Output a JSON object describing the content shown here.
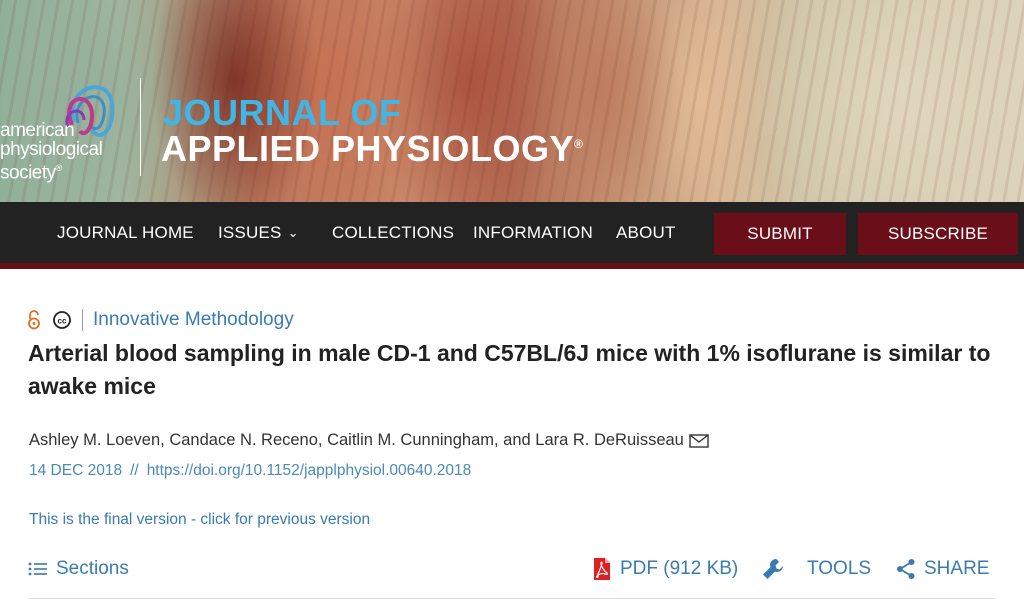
{
  "banner": {
    "society_name_lines": [
      "american",
      "physiological",
      "society"
    ],
    "society_name_suffix": "®",
    "journal_line1": "JOURNAL OF",
    "journal_line2": "APPLIED PHYSIOLOGY",
    "journal_line2_suffix": "®",
    "colors": {
      "journal_line1": "#3fb6e6",
      "journal_line2": "#ffffff"
    }
  },
  "nav": {
    "items": [
      {
        "label": "JOURNAL HOME"
      },
      {
        "label": "ISSUES",
        "has_dropdown": true
      },
      {
        "label": "COLLECTIONS"
      },
      {
        "label": "INFORMATION"
      },
      {
        "label": "ABOUT"
      }
    ],
    "submit_label": "SUBMIT",
    "subscribe_label": "SUBSCRIBE",
    "colors": {
      "bar": "#222222",
      "accent": "#6a0e1a"
    }
  },
  "article": {
    "icons": [
      "open-access-icon",
      "creative-commons-icon"
    ],
    "category": "Innovative Methodology",
    "title": "Arterial blood sampling in male CD-1 and C57BL/6J mice with 1% isoflurane is similar to awake mice",
    "authors": "Ashley M. Loeven, Candace N. Receno, Caitlin M. Cunningham, and Lara R. DeRuisseau",
    "date": "14 DEC 2018",
    "date_separator": "//",
    "doi": "https://doi.org/10.1152/japplphysiol.00640.2018",
    "version_note": "This is the final version - click for previous version"
  },
  "toolbar": {
    "sections_label": "Sections",
    "pdf_label": "PDF (912 KB)",
    "tools_label": "TOOLS",
    "share_label": "SHARE",
    "colors": {
      "link": "#3a7bb0",
      "pdf_icon": "#e02020",
      "open_access": "#e07020"
    }
  }
}
